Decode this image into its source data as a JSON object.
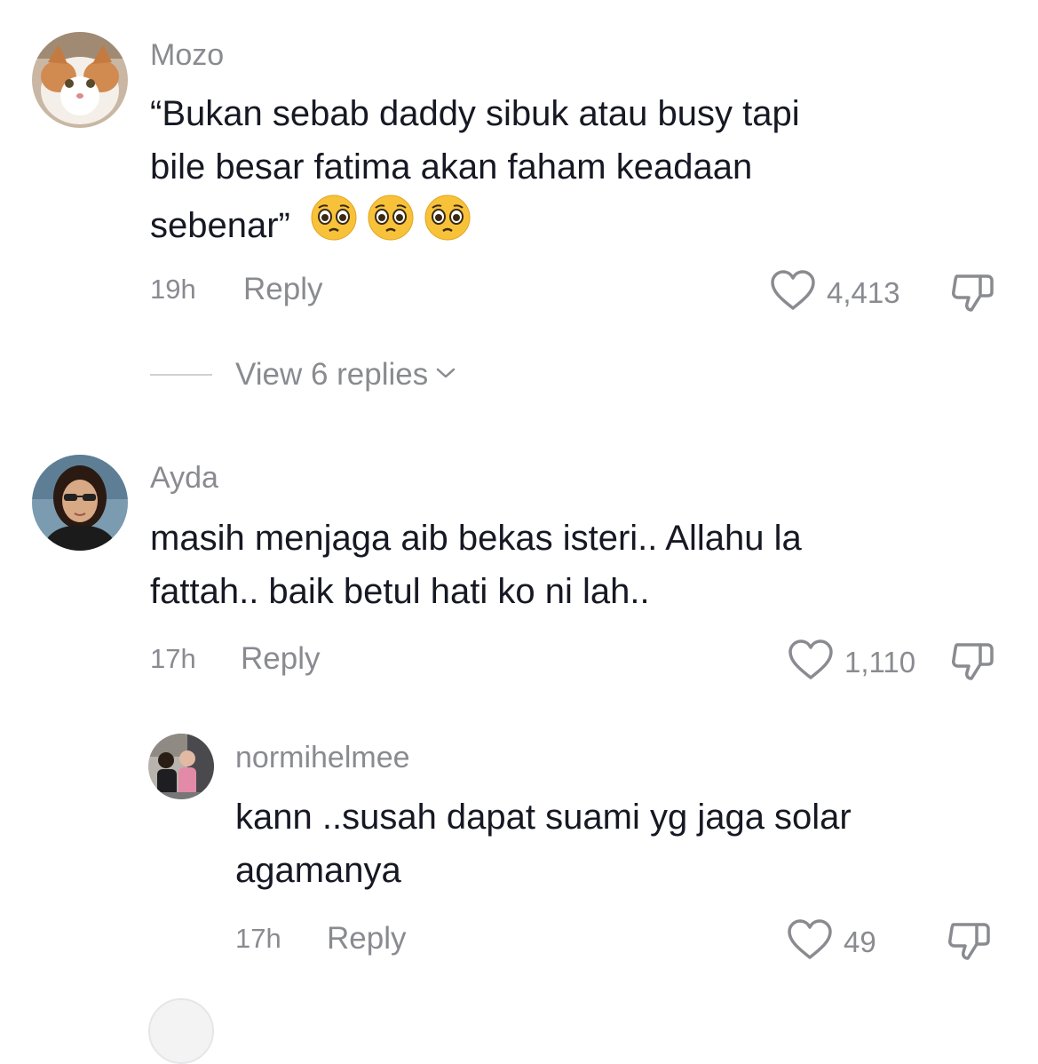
{
  "comments": [
    {
      "username": "Mozo",
      "text_lines": [
        "“Bukan sebab daddy sibuk atau busy tapi",
        "bile besar fatima akan faham keadaan",
        "sebenar”"
      ],
      "emojis": [
        "pleading-face",
        "pleading-face",
        "pleading-face"
      ],
      "time": "19h",
      "reply_label": "Reply",
      "likes": "4,413",
      "view_replies": "View 6 replies"
    },
    {
      "username": "Ayda",
      "text_lines": [
        "masih menjaga aib bekas isteri.. Allahu la",
        "fattah.. baik betul hati ko ni lah.."
      ],
      "time": "17h",
      "reply_label": "Reply",
      "likes": "1,110"
    }
  ],
  "replies": [
    {
      "username": "normihelmee",
      "text_lines": [
        "kann ..susah dapat suami yg jaga solar",
        "agamanya"
      ],
      "time": "17h",
      "reply_label": "Reply",
      "likes": "49"
    }
  ],
  "icons": {
    "like": "heart-outline-icon",
    "dislike": "thumbs-down-icon",
    "expand": "chevron-down-icon"
  },
  "colors": {
    "text": "#161823",
    "secondary": "#8a8b91"
  }
}
